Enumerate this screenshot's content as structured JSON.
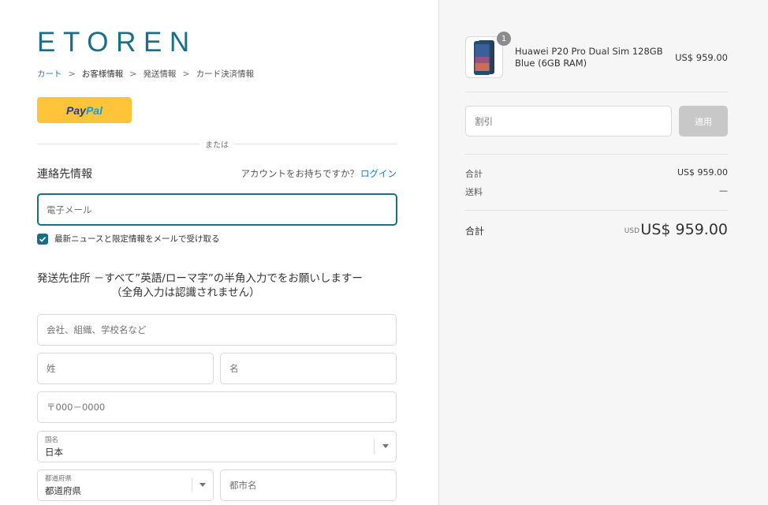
{
  "brand": {
    "logo_text": "ETOREN",
    "logo_color": "#1a6f87"
  },
  "breadcrumb": {
    "items": [
      {
        "label": "カート",
        "state": "link"
      },
      {
        "label": "お客様情報",
        "state": "current"
      },
      {
        "label": "発送情報",
        "state": "upcoming"
      },
      {
        "label": "カード決済情報",
        "state": "upcoming"
      }
    ],
    "separator": ">"
  },
  "express": {
    "paypal_pay": "Pay",
    "paypal_pal": "Pal"
  },
  "divider_text": "または",
  "contact": {
    "title": "連絡先情報",
    "account_prompt": "アカウントをお持ちですか？",
    "login_link": "ログイン",
    "email_placeholder": "電子メール",
    "email_value": "",
    "newsletter_label": "最新ニュースと限定情報をメールで受け取る",
    "newsletter_checked": true
  },
  "shipping": {
    "title_line1": "発送先住所 －すべて”英語/ローマ字”の半角入力でをお願いしますー",
    "title_line2": "（全角入力は認識されません）",
    "company_placeholder": "会社、組織、学校名など",
    "last_name_placeholder": "姓",
    "first_name_placeholder": "名",
    "postal_placeholder": "〒000－0000",
    "country": {
      "label": "国名",
      "value": "日本"
    },
    "prefecture": {
      "label": "都道府県",
      "value": "都道府県"
    },
    "city_placeholder": "都市名"
  },
  "order": {
    "item": {
      "name": "Huawei P20 Pro Dual Sim 128GB Blue (6GB RAM)",
      "quantity": "1",
      "price": "US$ 959.00"
    },
    "discount_placeholder": "割引",
    "apply_label": "適用",
    "subtotal_label": "合計",
    "subtotal_value": "US$ 959.00",
    "shipping_label": "送料",
    "shipping_value": "—",
    "total_label": "合計",
    "total_currency": "USD",
    "total_value": "US$ 959.00"
  }
}
